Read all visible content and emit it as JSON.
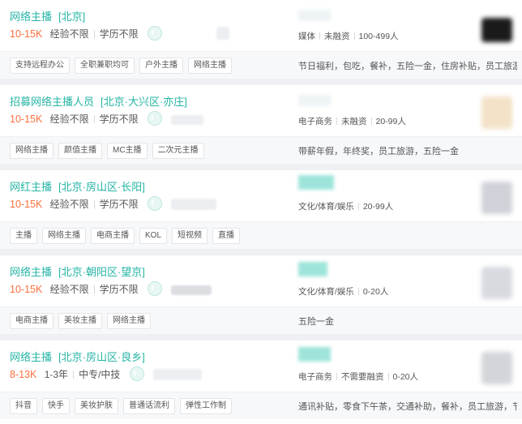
{
  "jobs": [
    {
      "title": "网络主播",
      "location": "[北京]",
      "salary": "10-15K",
      "experience": "经验不限",
      "education": "学历不限",
      "tags": [
        "支持远程办公",
        "全职兼职均可",
        "户外主播",
        "网络主播"
      ],
      "company_industry": "媒体",
      "company_funding": "未融资",
      "company_size": "100-499人",
      "welfare": "节日福利，包吃，餐补，五险一金，住房补贴，员工旅游…",
      "logo_color": "#1a1a1a"
    },
    {
      "title": "招募网络主播人员",
      "location": "[北京·大兴区·亦庄]",
      "salary": "10-15K",
      "experience": "经验不限",
      "education": "学历不限",
      "tags": [
        "网络主播",
        "颜值主播",
        "MC主播",
        "二次元主播"
      ],
      "company_industry": "电子商务",
      "company_funding": "未融资",
      "company_size": "20-99人",
      "welfare": "带薪年假，年终奖，员工旅游，五险一金",
      "logo_color": "#f3e2c8"
    },
    {
      "title": "网红主播",
      "location": "[北京·房山区·长阳]",
      "salary": "10-15K",
      "experience": "经验不限",
      "education": "学历不限",
      "tags": [
        "主播",
        "网络主播",
        "电商主播",
        "KOL",
        "短视频",
        "直播"
      ],
      "company_industry": "文化/体育/娱乐",
      "company_funding": "",
      "company_size": "20-99人",
      "welfare": "",
      "logo_color": "#cfd2d8"
    },
    {
      "title": "网络主播",
      "location": "[北京·朝阳区·望京]",
      "salary": "10-15K",
      "experience": "经验不限",
      "education": "学历不限",
      "tags": [
        "电商主播",
        "美妆主播",
        "网络主播"
      ],
      "company_industry": "文化/体育/娱乐",
      "company_funding": "",
      "company_size": "0-20人",
      "welfare": "五险一金",
      "logo_color": "#d8dae0"
    },
    {
      "title": "网络主播",
      "location": "[北京·房山区·良乡]",
      "salary": "8-13K",
      "experience": "1-3年",
      "education": "中专/中技",
      "tags": [
        "抖音",
        "快手",
        "美妆护肤",
        "普通话流利",
        "弹性工作制"
      ],
      "company_industry": "电子商务",
      "company_funding": "不需要融资",
      "company_size": "0-20人",
      "welfare": "通讯补贴，零食下午茶，交通补助，餐补，员工旅游，节…",
      "logo_color": "#d3d5da"
    }
  ]
}
